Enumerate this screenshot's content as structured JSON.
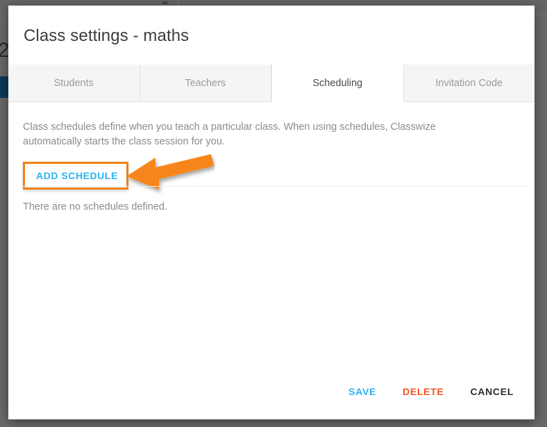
{
  "background": {
    "numeral": "2"
  },
  "dialog": {
    "title": "Class settings - maths",
    "tabs": [
      {
        "label": "Students",
        "active": false
      },
      {
        "label": "Teachers",
        "active": false
      },
      {
        "label": "Scheduling",
        "active": true
      },
      {
        "label": "Invitation Code",
        "active": false
      }
    ],
    "description": "Class schedules define when you teach a particular class. When using schedules, Classwize automatically starts the class session for you.",
    "add_schedule_label": "ADD SCHEDULE",
    "empty_state": "There are no schedules defined.",
    "footer": {
      "save_label": "SAVE",
      "delete_label": "DELETE",
      "cancel_label": "CANCEL"
    }
  },
  "annotation": {
    "highlight_color": "#ef8216",
    "arrow_color": "#f6861f",
    "arrow_direction": "left"
  },
  "colors": {
    "accent_blue": "#2bb3f0",
    "delete_red": "#f4511e",
    "cancel_dark": "#2e2e2e",
    "scrim_gray": "#6b6b6b",
    "navbar_navy": "#0d3b5c",
    "tab_inactive_bg": "#f5f5f5",
    "tab_active_bg": "#ffffff"
  }
}
